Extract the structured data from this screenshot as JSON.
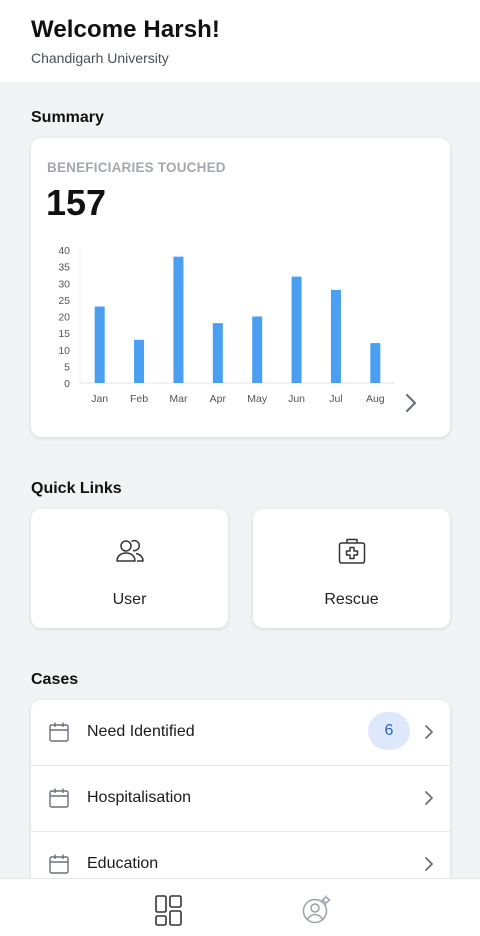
{
  "header": {
    "title": "Welcome Harsh!",
    "subtitle": "Chandigarh University"
  },
  "summary": {
    "section_title": "Summary",
    "kpi_label": "BENEFICIARIES TOUCHED",
    "kpi_value": "157",
    "next_icon": "chevron-right-icon"
  },
  "chart_data": {
    "type": "bar",
    "categories": [
      "Jan",
      "Feb",
      "Mar",
      "Apr",
      "May",
      "Jun",
      "Jul",
      "Aug"
    ],
    "values": [
      23,
      13,
      38,
      18,
      20,
      32,
      28,
      12
    ],
    "yticks": [
      0,
      5,
      10,
      15,
      20,
      25,
      30,
      35,
      40
    ],
    "ylim": [
      0,
      40
    ],
    "title": "",
    "xlabel": "",
    "ylabel": "",
    "grid": false,
    "bar_color": "#4a9ff2"
  },
  "quick_links": {
    "section_title": "Quick Links",
    "items": [
      {
        "label": "User",
        "icon": "users-icon"
      },
      {
        "label": "Rescue",
        "icon": "first-aid-kit-icon"
      }
    ]
  },
  "cases": {
    "section_title": "Cases",
    "items": [
      {
        "label": "Need Identified",
        "badge": "6",
        "icon": "calendar-icon"
      },
      {
        "label": "Hospitalisation",
        "icon": "calendar-icon"
      },
      {
        "label": "Education",
        "icon": "calendar-icon"
      }
    ]
  },
  "bottom_nav": {
    "items": [
      {
        "icon": "dashboard-icon"
      },
      {
        "icon": "user-settings-icon"
      }
    ]
  },
  "colors": {
    "accent": "#4a9ff2",
    "badge_bg": "#dde9fb",
    "badge_text": "#2a63c6",
    "background": "#f2f3f5"
  }
}
